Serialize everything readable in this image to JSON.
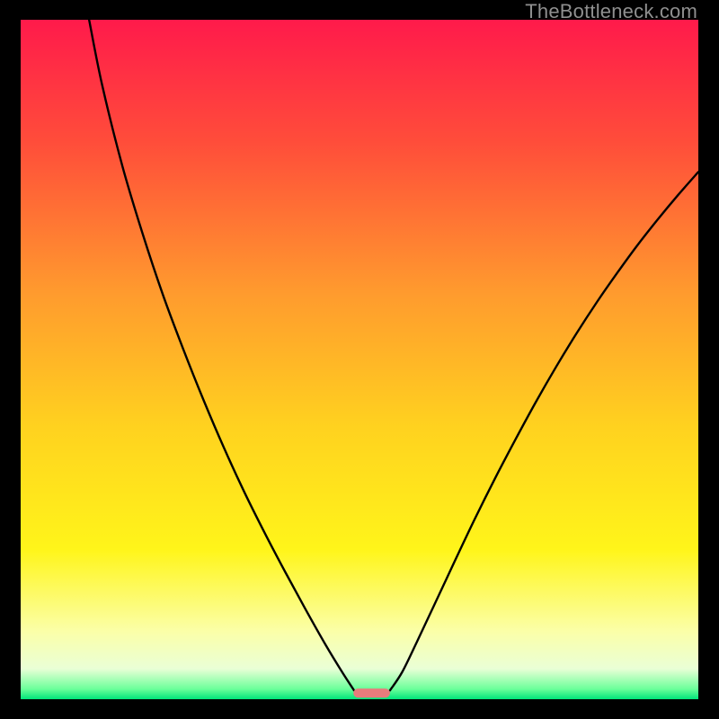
{
  "watermark": "TheBottleneck.com",
  "chart_data": {
    "type": "line",
    "title": "",
    "xlabel": "",
    "ylabel": "",
    "xlim": [
      0,
      100
    ],
    "ylim": [
      0,
      100
    ],
    "gradient_stops": [
      {
        "offset": 0.0,
        "color": "#ff1a4b"
      },
      {
        "offset": 0.18,
        "color": "#ff4d3a"
      },
      {
        "offset": 0.4,
        "color": "#ff9a2e"
      },
      {
        "offset": 0.6,
        "color": "#ffd21f"
      },
      {
        "offset": 0.78,
        "color": "#fff51a"
      },
      {
        "offset": 0.9,
        "color": "#fbffa8"
      },
      {
        "offset": 0.955,
        "color": "#eaffd6"
      },
      {
        "offset": 0.985,
        "color": "#6bff9a"
      },
      {
        "offset": 1.0,
        "color": "#00e47a"
      }
    ],
    "series": [
      {
        "name": "left-branch",
        "x": [
          10.1,
          12,
          15,
          18,
          21,
          24,
          27,
          30,
          33,
          36,
          39,
          42,
          45,
          47.5,
          49.2
        ],
        "y": [
          100,
          90.5,
          78.5,
          68.5,
          59.5,
          51.5,
          44,
          37,
          30.5,
          24.5,
          18.8,
          13.3,
          8.0,
          3.9,
          1.3
        ]
      },
      {
        "name": "right-branch",
        "x": [
          54.5,
          56.3,
          58.5,
          61,
          64,
          67,
          70,
          73,
          76,
          79,
          82,
          85,
          88,
          91,
          94,
          97,
          100
        ],
        "y": [
          1.3,
          4.0,
          8.5,
          13.8,
          20.2,
          26.5,
          32.5,
          38.2,
          43.7,
          48.9,
          53.8,
          58.4,
          62.7,
          66.8,
          70.6,
          74.2,
          77.6
        ]
      }
    ],
    "marker": {
      "name": "bottom-pill",
      "x": 51.8,
      "y": 0.9,
      "width": 5.4,
      "height": 1.35,
      "color": "#e77c7c"
    }
  }
}
